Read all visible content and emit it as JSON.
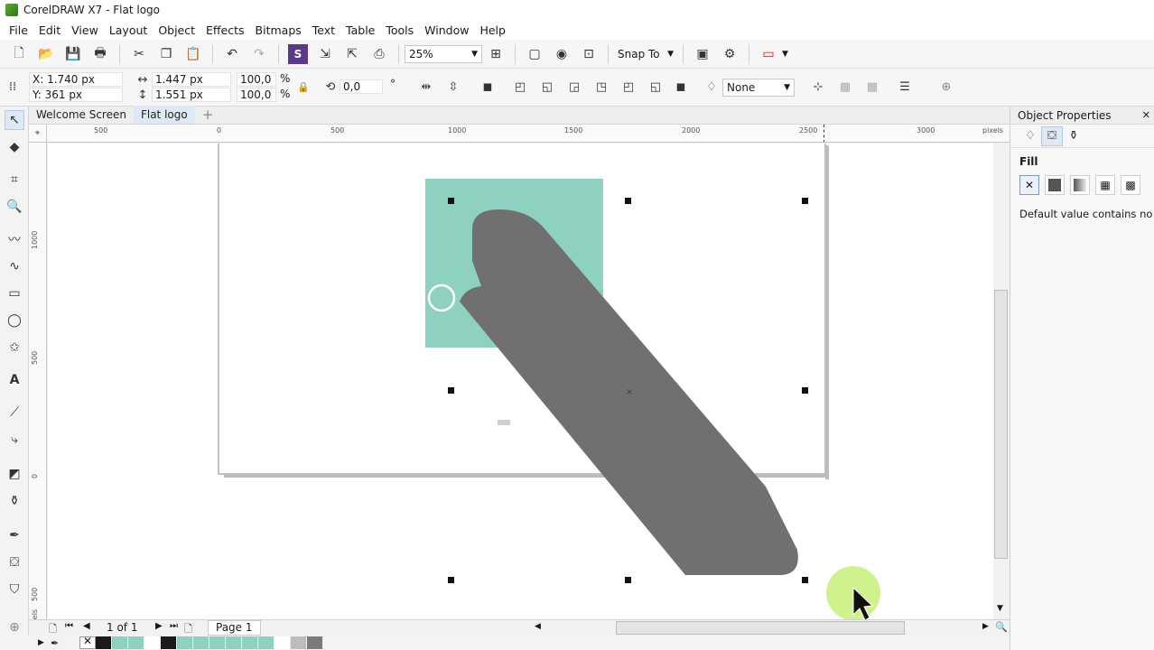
{
  "window": {
    "title": "CorelDRAW X7 - Flat logo"
  },
  "menu": [
    "File",
    "Edit",
    "View",
    "Layout",
    "Object",
    "Effects",
    "Bitmaps",
    "Text",
    "Table",
    "Tools",
    "Window",
    "Help"
  ],
  "standard_toolbar": {
    "zoom": "25%",
    "snap_to": "Snap To"
  },
  "property_bar": {
    "x": "X: 1.740 px",
    "y": "Y: 361 px",
    "width": "1.447 px",
    "height": "1.551 px",
    "scale_x": "100,0",
    "scale_y": "100,0",
    "pct": "%",
    "rotation": "0,0",
    "deg": "°",
    "outline": "None"
  },
  "document_tabs": [
    "Welcome Screen",
    "Flat logo"
  ],
  "rulers": {
    "horizontal_ticks": [
      "500",
      "0",
      "500",
      "1000",
      "1500",
      "2000",
      "2500",
      "3000",
      "pixels"
    ],
    "vertical_ticks": [
      "1000",
      "500",
      "0",
      "500",
      "pixels"
    ]
  },
  "page_nav": {
    "counter": "1 of 1",
    "page_tab": "Page 1"
  },
  "docker": {
    "title": "Object Properties",
    "section": "Fill",
    "note": "Default value contains no fill"
  },
  "colors": {
    "accent": "#8fd1c0",
    "shape": "#707070",
    "tab_active": "#dfe9f5",
    "cursor_highlight": "#c8f07a"
  },
  "palette": [
    "#000000",
    "#8fd1c0",
    "#8fd1c0",
    "#ffffff",
    "#1a1a1a",
    "#8fd1c0",
    "#8fd1c0",
    "#8fd1c0",
    "#8fd1c0",
    "#8fd1c0",
    "#8fd1c0",
    "#ffffff",
    "#1a1a1a",
    "#bdbdbd",
    "#7a7a7a"
  ]
}
